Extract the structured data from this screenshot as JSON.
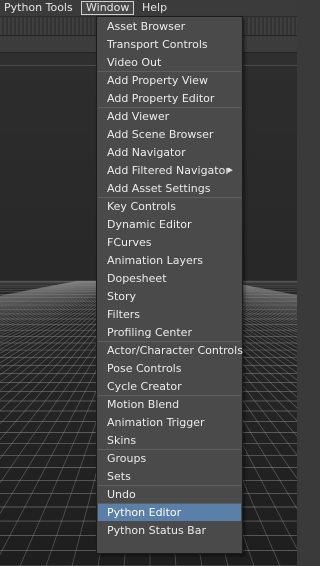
{
  "menubar": {
    "items": [
      "Python Tools",
      "Window",
      "Help"
    ]
  },
  "window_menu": {
    "groups": [
      [
        "Asset Browser",
        "Transport Controls",
        "Video Out"
      ],
      [
        "Add Property View",
        "Add Property Editor"
      ],
      [
        "Add Viewer",
        "Add Scene Browser",
        "Add Navigator",
        "Add Filtered Navigator",
        "Add Asset Settings"
      ],
      [
        "Key Controls",
        "Dynamic Editor",
        "FCurves",
        "Animation Layers",
        "Dopesheet",
        "Story",
        "Filters",
        "Profiling Center"
      ],
      [
        "Actor/Character Controls",
        "Pose Controls",
        "Cycle Creator"
      ],
      [
        "Motion Blend",
        "Animation Trigger",
        "Skins"
      ],
      [
        "Groups",
        "Sets"
      ],
      [
        "Undo"
      ],
      [
        "Python Editor",
        "Python Status Bar"
      ]
    ],
    "highlighted": "Python Editor",
    "submenu_item": "Add Filtered Navigator",
    "highlight_color": "#5a7fa8"
  }
}
